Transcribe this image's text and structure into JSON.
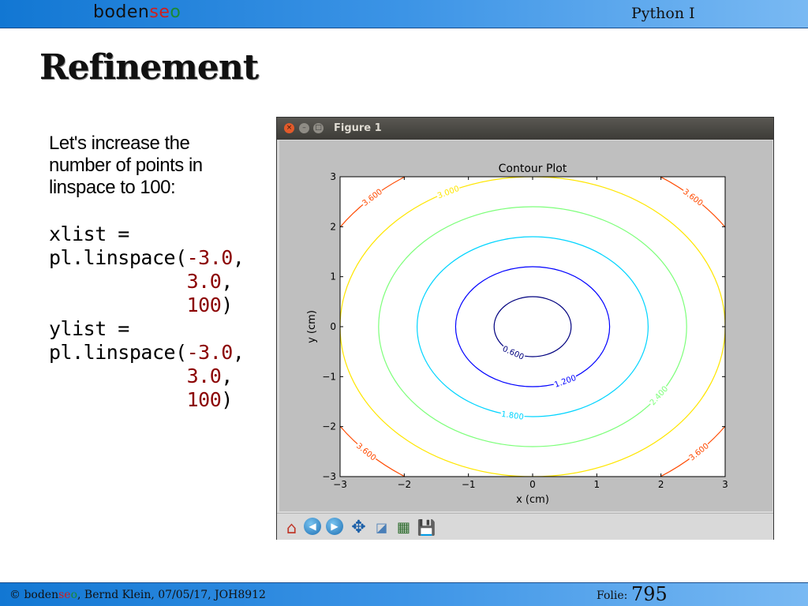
{
  "header": {
    "logo_part1": "boden",
    "logo_part2": "se",
    "logo_part3": "o",
    "course": "Python I"
  },
  "slide": {
    "title": "Refinement",
    "intro": "Let's increase the number of points in linspace to 100:",
    "code": {
      "line1": "xlist =",
      "line2_prefix": "pl.linspace(",
      "line2_num": "-3.0",
      "line2_suffix": ",",
      "line3_num": "3.0",
      "line3_suffix": ",",
      "line4_num": "100",
      "line4_suffix": ")",
      "line5": "ylist =",
      "line6_prefix": "pl.linspace(",
      "line6_num": "-3.0",
      "line6_suffix": ",",
      "line7_num": "3.0",
      "line7_suffix": ",",
      "line8_num": "100",
      "line8_suffix": ")"
    }
  },
  "figure_window": {
    "title": "Figure 1",
    "close_glyph": "×",
    "min_glyph": "–",
    "max_glyph": "□",
    "toolbar": {
      "home_icon": "home-icon",
      "back_icon": "back-arrow-icon",
      "forward_icon": "forward-arrow-icon",
      "pan_icon": "pan-move-icon",
      "zoom_icon": "zoom-rect-icon",
      "subplots_icon": "subplots-config-icon",
      "save_icon": "save-floppy-icon",
      "home_glyph": "⌂",
      "back_glyph": "◀",
      "forward_glyph": "▶",
      "pan_glyph": "✥",
      "zoom_glyph": "◪",
      "subplots_glyph": "▦",
      "save_glyph": "💾"
    }
  },
  "chart_data": {
    "type": "contour",
    "title": "Contour Plot",
    "xlabel": "x (cm)",
    "ylabel": "y (cm)",
    "xlim": [
      -3,
      3
    ],
    "ylim": [
      -3,
      3
    ],
    "xticks": [
      -3,
      -2,
      -1,
      0,
      1,
      2,
      3
    ],
    "yticks": [
      -3,
      -2,
      -1,
      0,
      1,
      2,
      3
    ],
    "xtick_labels": [
      "−3",
      "−2",
      "−1",
      "0",
      "1",
      "2",
      "3"
    ],
    "ytick_labels": [
      "−3",
      "−2",
      "−1",
      "0",
      "1",
      "2",
      "3"
    ],
    "function": "sqrt(x^2 + y^2)",
    "levels": [
      {
        "value": 0.6,
        "label": "0.600",
        "color": "#00007f"
      },
      {
        "value": 1.2,
        "label": "1.200",
        "color": "#0000ff"
      },
      {
        "value": 1.8,
        "label": "1.800",
        "color": "#00d4ff"
      },
      {
        "value": 2.4,
        "label": "2.400",
        "color": "#7dff7a"
      },
      {
        "value": 3.0,
        "label": "3.000",
        "color": "#ffe600"
      },
      {
        "value": 3.6,
        "label": "3.600",
        "color": "#ff4a00"
      }
    ],
    "grid": false
  },
  "footer": {
    "copyright": "© ",
    "logo_part1": "boden",
    "logo_part2": "se",
    "logo_part3": "o",
    "author_date": ", Bernd Klein, 07/05/17, JOH8912",
    "folie_label": "Folie:",
    "folie_number": "795"
  }
}
